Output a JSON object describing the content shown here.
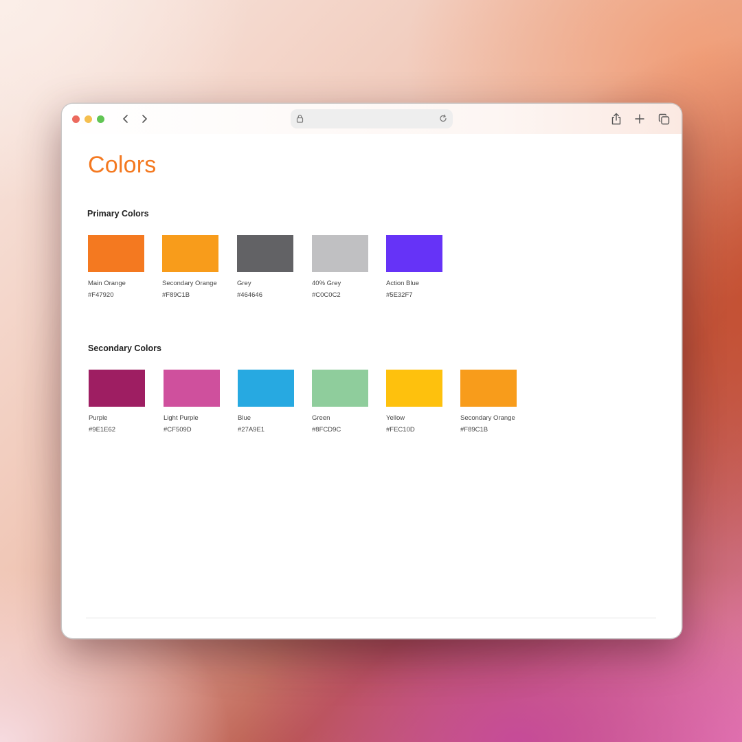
{
  "page": {
    "title": "Colors"
  },
  "primary": {
    "heading": "Primary Colors",
    "swatches": [
      {
        "name": "Main Orange",
        "hex": "#F47920",
        "color": "#F47920"
      },
      {
        "name": "Secondary Orange",
        "hex": "#F89C1B",
        "color": "#F89C1B"
      },
      {
        "name": "Grey",
        "hex": "#464646",
        "color": "#626265"
      },
      {
        "name": "40% Grey",
        "hex": "#C0C0C2",
        "color": "#C0C0C2"
      },
      {
        "name": "Action Blue",
        "hex": "#5E32F7",
        "color": "#6633F7"
      }
    ]
  },
  "secondary": {
    "heading": "Secondary Colors",
    "swatches": [
      {
        "name": "Purple",
        "hex": "#9E1E62",
        "color": "#9E1E62"
      },
      {
        "name": "Light Purple",
        "hex": "#CF509D",
        "color": "#CF509D"
      },
      {
        "name": "Blue",
        "hex": "#27A9E1",
        "color": "#27A9E1"
      },
      {
        "name": "Green",
        "hex": "#8FCD9C",
        "color": "#8FCD9C"
      },
      {
        "name": "Yellow",
        "hex": "#FEC10D",
        "color": "#FEC10D"
      },
      {
        "name": "Secondary Orange",
        "hex": "#F89C1B",
        "color": "#F89C1B"
      }
    ]
  },
  "browser": {
    "icons": [
      "close-dot",
      "minimize-dot",
      "zoom-dot",
      "back-icon",
      "forward-icon",
      "lock-icon",
      "reload-icon",
      "share-icon",
      "new-tab-icon",
      "tabs-overview-icon"
    ]
  }
}
